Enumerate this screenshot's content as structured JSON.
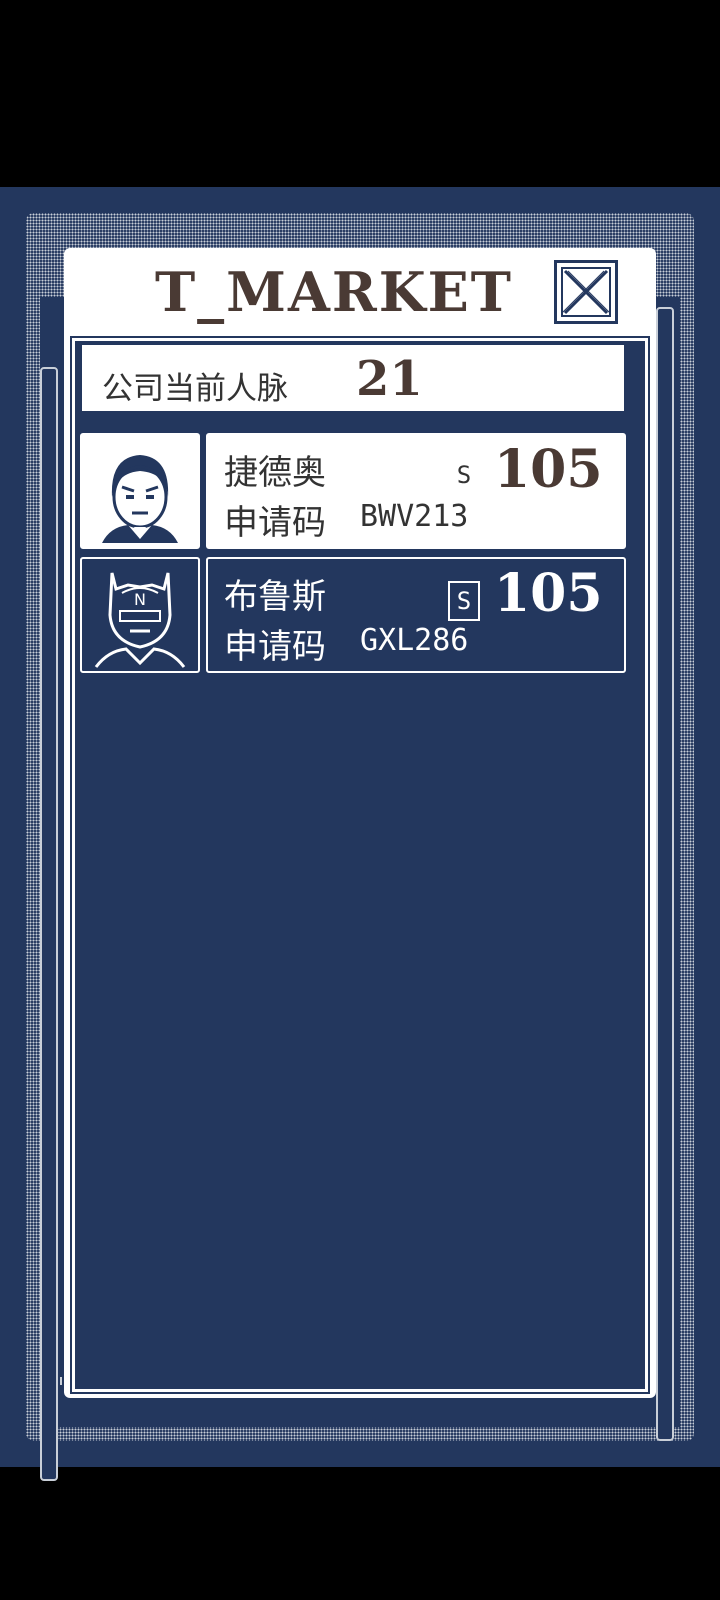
{
  "window": {
    "title": "T_MARKET"
  },
  "network": {
    "label": "公司当前人脉",
    "value": "21"
  },
  "contacts": [
    {
      "name": "捷德奥",
      "code_label": "申请码",
      "code": "BWV213",
      "rank": "S",
      "score": "105",
      "selected": false
    },
    {
      "name": "布鲁斯",
      "code_label": "申请码",
      "code": "GXL286",
      "rank": "S",
      "score": "105",
      "selected": true
    }
  ],
  "icons": {
    "close": "close-icon",
    "avatar1": "businessman-avatar-icon",
    "avatar2": "masked-hero-avatar-icon"
  },
  "colors": {
    "background": "#23375e",
    "panel": "#ffffff",
    "title_text": "#4a3a34"
  }
}
